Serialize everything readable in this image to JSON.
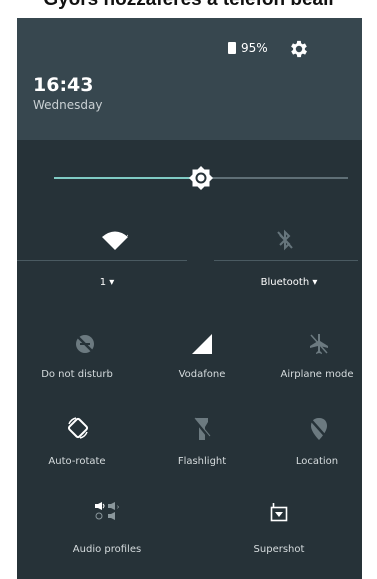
{
  "caption": "Gyors hozzáférés a telefon beáll",
  "status": {
    "battery": "95%"
  },
  "header": {
    "time": "16:43",
    "day": "Wednesday"
  },
  "brightness": {
    "level": 0.5
  },
  "wifi": {
    "label": "1"
  },
  "bluetooth": {
    "label": "Bluetooth"
  },
  "tiles": {
    "dnd": "Do not disturb",
    "cellular": "Vodafone",
    "airplane": "Airplane mode",
    "rotate": "Auto-rotate",
    "flashlight": "Flashlight",
    "location": "Location",
    "audio": "Audio profiles",
    "supershot": "Supershot"
  },
  "colors": {
    "panel": "#263238",
    "header": "#37474f",
    "accent": "#80cbc4"
  }
}
